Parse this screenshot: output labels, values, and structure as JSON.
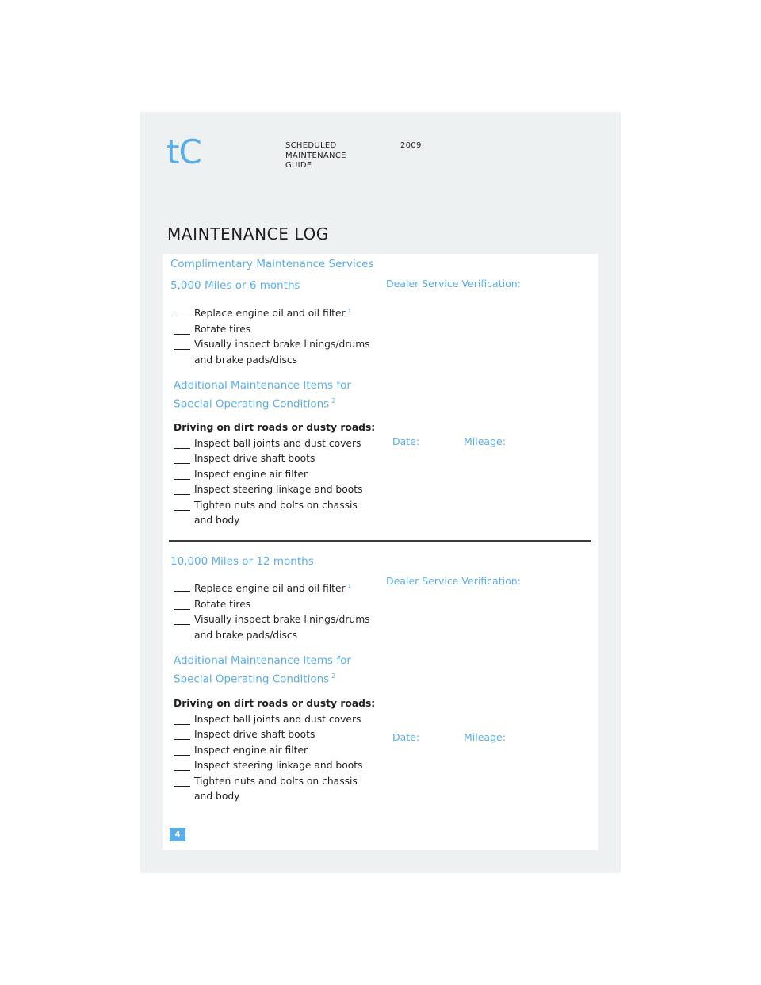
{
  "header": {
    "brand": "tC",
    "guide_lines": [
      "SCHEDULED",
      "MAINTENANCE",
      "GUIDE"
    ],
    "year": "2009"
  },
  "page_title": "MAINTENANCE LOG",
  "colors": {
    "accent": "#5aaee8",
    "page_bg": "#eef1f2",
    "panel_bg": "#ffffff",
    "text": "#231f20"
  },
  "complimentary_heading": "Complimentary Maintenance Services",
  "sections": [
    {
      "interval": "5,000 Miles or 6 months",
      "items": [
        {
          "text": "Replace engine oil and oil filter",
          "footnote": "1"
        },
        {
          "text": "Rotate tires"
        },
        {
          "text": "Visually inspect brake linings/drums and brake pads/discs"
        }
      ],
      "additional_heading_line1": "Additional Maintenance Items for",
      "additional_heading_line2": "Special Operating Conditions",
      "additional_footnote": "2",
      "condition_label": "Driving on dirt roads or dusty roads:",
      "condition_items": [
        {
          "text": "Inspect ball joints and dust covers"
        },
        {
          "text": "Inspect drive shaft boots"
        },
        {
          "text": "Inspect engine air filter"
        },
        {
          "text": "Inspect steering linkage and boots"
        },
        {
          "text": "Tighten nuts and bolts on chassis and body"
        }
      ],
      "verification_label": "Dealer Service Verification:",
      "date_label": "Date:",
      "mileage_label": "Mileage:"
    },
    {
      "interval": "10,000 Miles or 12 months",
      "items": [
        {
          "text": "Replace engine oil and oil filter",
          "footnote": "1"
        },
        {
          "text": "Rotate tires"
        },
        {
          "text": "Visually inspect brake linings/drums and brake pads/discs"
        }
      ],
      "additional_heading_line1": "Additional Maintenance Items for",
      "additional_heading_line2": "Special Operating Conditions",
      "additional_footnote": "2",
      "condition_label": "Driving on dirt roads or dusty roads:",
      "condition_items": [
        {
          "text": "Inspect ball joints and dust covers"
        },
        {
          "text": "Inspect drive shaft boots"
        },
        {
          "text": "Inspect engine air filter"
        },
        {
          "text": "Inspect steering linkage and boots"
        },
        {
          "text": "Tighten nuts and bolts on chassis and body"
        }
      ],
      "verification_label": "Dealer Service Verification:",
      "date_label": "Date:",
      "mileage_label": "Mileage:"
    }
  ],
  "page_number": "4"
}
